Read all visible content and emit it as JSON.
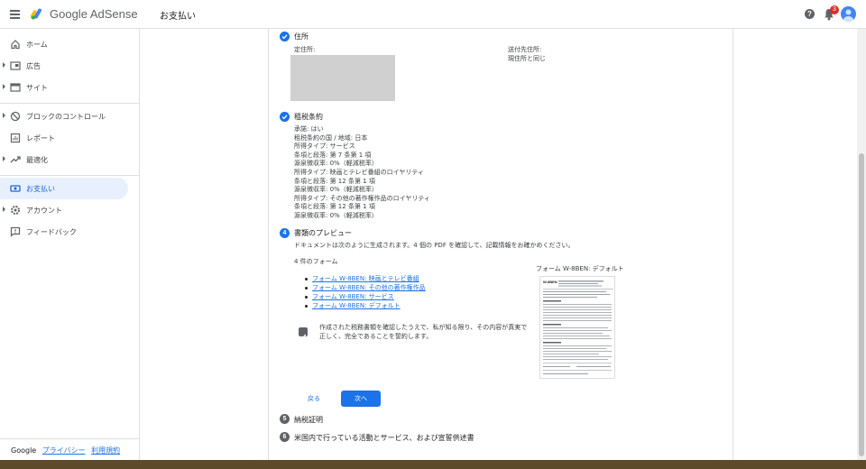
{
  "topbar": {
    "brand": "Google AdSense",
    "page_title": "お支払い",
    "notification_count": "3",
    "help_glyph": "?"
  },
  "sidebar": {
    "items": [
      {
        "label": "ホーム",
        "icon": "home-icon",
        "expandable": false
      },
      {
        "label": "広告",
        "icon": "ads-icon",
        "expandable": true
      },
      {
        "label": "サイト",
        "icon": "sites-icon",
        "expandable": true
      },
      {
        "label": "ブロックのコントロール",
        "icon": "block-icon",
        "expandable": true
      },
      {
        "label": "レポート",
        "icon": "reports-icon",
        "expandable": false
      },
      {
        "label": "最適化",
        "icon": "optimize-icon",
        "expandable": true
      },
      {
        "label": "お支払い",
        "icon": "payments-icon",
        "expandable": false,
        "active": true
      },
      {
        "label": "アカウント",
        "icon": "account-gear-icon",
        "expandable": true
      },
      {
        "label": "フィードバック",
        "icon": "feedback-icon",
        "expandable": false
      }
    ],
    "footer": {
      "google": "Google",
      "privacy": "プライバシー",
      "terms": "利用規約"
    }
  },
  "address_step": {
    "title": "住所",
    "permanent_label": "定住所:",
    "mailing_label": "送付先住所:",
    "mailing_value": "現住所と同じ"
  },
  "treaty_step": {
    "title": "租税条約",
    "lines": [
      "承諾: はい",
      "租税条約の国 / 地域: 日本",
      "所得タイプ: サービス",
      "条項と段落: 第 7 条第 1 項",
      "源泉徴収率: 0%（軽減税率）",
      "所得タイプ: 映画とテレビ番組のロイヤリティ",
      "条項と段落: 第 12 条第 1 項",
      "源泉徴収率: 0%（軽減税率）",
      "所得タイプ: その他の著作権作品のロイヤリティ",
      "条項と段落: 第 12 条第 1 項",
      "源泉徴収率: 0%（軽減税率）"
    ]
  },
  "preview_step": {
    "number": "4",
    "title": "書類のプレビュー",
    "description": "ドキュメントは次のように生成されます。4 個の PDF を確認して、記載情報をお確かめください。",
    "forms_heading": "4 件のフォーム",
    "forms": [
      "フォーム W-8BEN: 映画とテレビ番組",
      "フォーム W-8BEN: その他の著作権作品",
      "フォーム W-8BEN: サービス",
      "フォーム W-8BEN: デフォルト"
    ],
    "thumbnail_caption": "フォーム W-8BEN: デフォルト",
    "thumbnail_form_id": "W-8BEN",
    "certify_line1": "作成された税務書類を確認したうえで、私が知る限り、その内容が真実で",
    "certify_line2": "正しく、完全であることを誓約します。",
    "certify_checked": true,
    "back_label": "戻る",
    "next_label": "次へ"
  },
  "later_steps": [
    {
      "number": "5",
      "title": "納税証明"
    },
    {
      "number": "6",
      "title": "米国内で行っている活動とサービス、および宣誓供述書"
    }
  ],
  "colors": {
    "accent": "#1a73e8",
    "active_nav_bg": "#e8f0fe",
    "badge": "#d93025"
  }
}
